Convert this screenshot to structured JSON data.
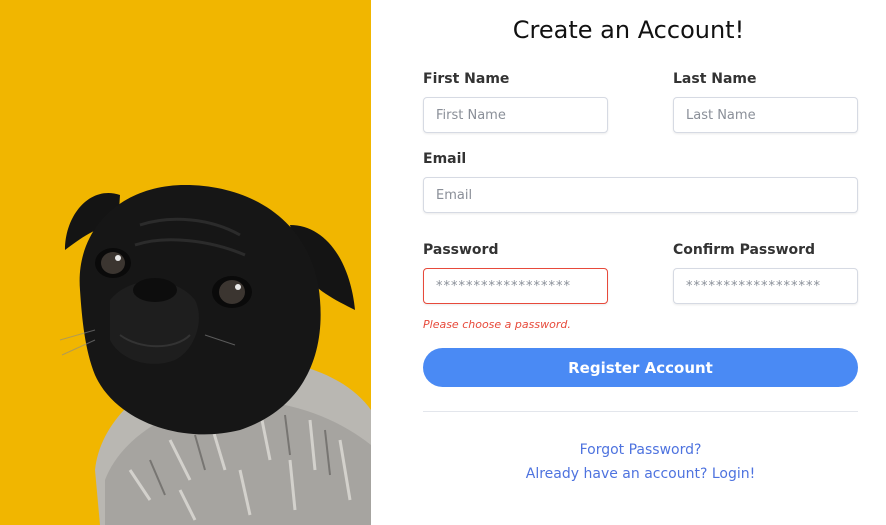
{
  "form": {
    "title": "Create an Account!",
    "first_name": {
      "label": "First Name",
      "placeholder": "First Name"
    },
    "last_name": {
      "label": "Last Name",
      "placeholder": "Last Name"
    },
    "email": {
      "label": "Email",
      "placeholder": "Email"
    },
    "password": {
      "label": "Password",
      "placeholder": "******************",
      "error": "Please choose a password."
    },
    "confirm_password": {
      "label": "Confirm Password",
      "placeholder": "******************"
    },
    "register_button": "Register Account",
    "forgot_password_link": "Forgot Password?",
    "login_link": "Already have an account? Login!"
  },
  "colors": {
    "photo_background": "#f1b600",
    "primary_button": "#4a8af4",
    "error": "#e74a3b",
    "link": "#4e73df"
  },
  "image": {
    "subject": "black pug wearing a knitted grey sweater"
  }
}
